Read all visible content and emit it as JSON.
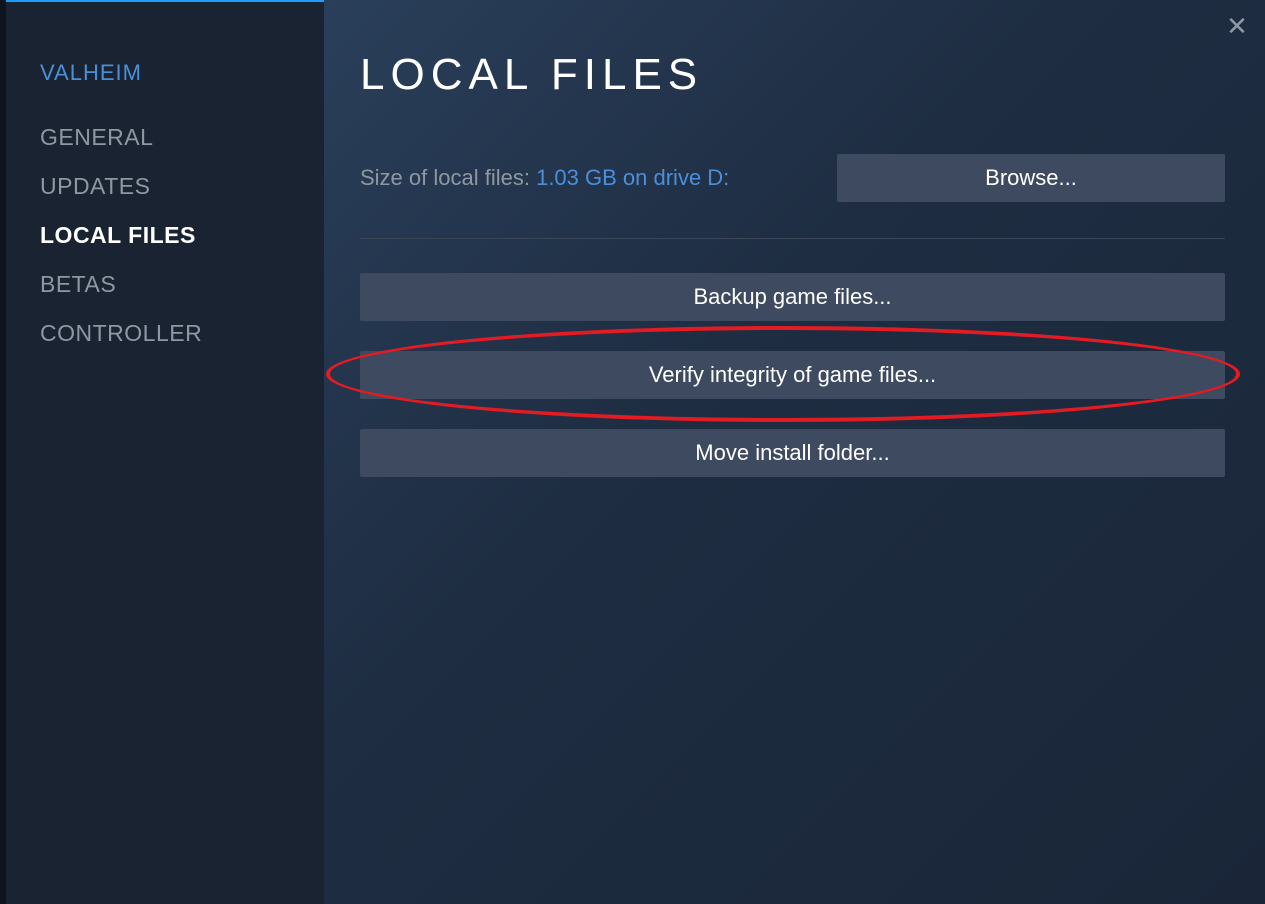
{
  "game_title": "VALHEIM",
  "sidebar": {
    "items": [
      {
        "label": "GENERAL",
        "active": false
      },
      {
        "label": "UPDATES",
        "active": false
      },
      {
        "label": "LOCAL FILES",
        "active": true
      },
      {
        "label": "BETAS",
        "active": false
      },
      {
        "label": "CONTROLLER",
        "active": false
      }
    ]
  },
  "main": {
    "title": "LOCAL FILES",
    "size_label": "Size of local files: ",
    "size_value": "1.03 GB on drive D:",
    "browse_label": "Browse...",
    "buttons": {
      "backup": "Backup game files...",
      "verify": "Verify integrity of game files...",
      "move": "Move install folder..."
    }
  },
  "close_symbol": "✕"
}
